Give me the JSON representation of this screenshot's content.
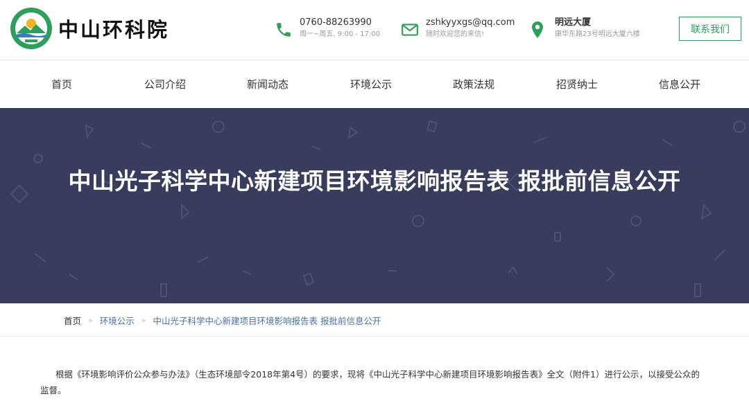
{
  "header": {
    "logo_text": "中山环科院",
    "phone": {
      "number": "0760-88263990",
      "hours": "周一~周五, 9:00 - 17:00"
    },
    "email": {
      "address": "zshkyyxgs@qq.com",
      "note": "随时欢迎您的来信!"
    },
    "address": {
      "building": "明远大厦",
      "street": "康华东路23号明远大厦六楼"
    },
    "contact_button": "联系我们"
  },
  "nav": {
    "items": [
      {
        "label": "首页"
      },
      {
        "label": "公司介绍"
      },
      {
        "label": "新闻动态"
      },
      {
        "label": "环境公示"
      },
      {
        "label": "政策法规"
      },
      {
        "label": "招贤纳士"
      },
      {
        "label": "信息公开"
      }
    ]
  },
  "banner": {
    "title": "中山光子科学中心新建项目环境影响报告表 报批前信息公开"
  },
  "breadcrumb": {
    "home": "首页",
    "section": "环境公示",
    "current": "中山光子科学中心新建项目环境影响报告表 报批前信息公开"
  },
  "content": {
    "paragraph": "根据《环境影响评价公众参与办法》（生态环境部令2018年第4号）的要求，现将《中山光子科学中心新建项目环境影响报告表》全文（附件1）进行公示，以接受公众的监督。"
  },
  "colors": {
    "brand_green": "#2e9e5b",
    "banner_bg": "#393c5c",
    "link_blue": "#4a6fa5"
  }
}
